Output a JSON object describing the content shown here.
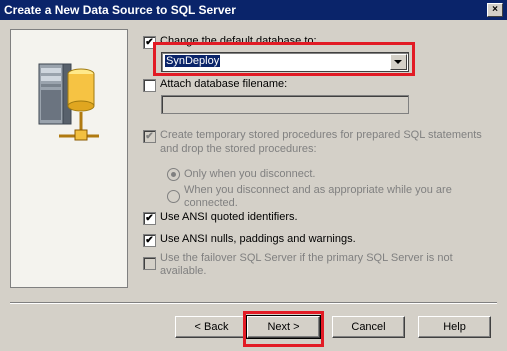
{
  "window": {
    "title": "Create a New Data Source to SQL Server",
    "close_glyph": "×"
  },
  "options": {
    "change_default_db": {
      "label": "Change the default database to:",
      "checked": true
    },
    "default_db_value": "SynDeploy",
    "attach_db": {
      "label": "Attach database filename:",
      "checked": false,
      "value": ""
    },
    "temp_procs": {
      "label_line1": "Create temporary stored procedures for prepared SQL statements",
      "label_line2": "and drop the stored procedures:",
      "checked": true,
      "enabled": false
    },
    "radio_only_disconnect": {
      "label": "Only when you disconnect.",
      "selected": true
    },
    "radio_when_disconnect": {
      "label_line1": "When you disconnect and as appropriate while you are",
      "label_line2": "connected.",
      "selected": false
    },
    "ansi_quoted": {
      "label": "Use ANSI quoted identifiers.",
      "checked": true
    },
    "ansi_nulls": {
      "label": "Use ANSI nulls, paddings and warnings.",
      "checked": true
    },
    "failover": {
      "label_line1": "Use the failover SQL Server if the primary SQL Server is not",
      "label_line2": "available.",
      "checked": false,
      "enabled": false
    }
  },
  "buttons": {
    "back": "< Back",
    "next": "Next >",
    "cancel": "Cancel",
    "help": "Help"
  },
  "icons": {
    "server": "server-database-icon",
    "check": "✔"
  },
  "colors": {
    "highlight_box": "#e21b25",
    "title_bar": "#0a246a",
    "dialog_bg": "#d4d0c8"
  }
}
